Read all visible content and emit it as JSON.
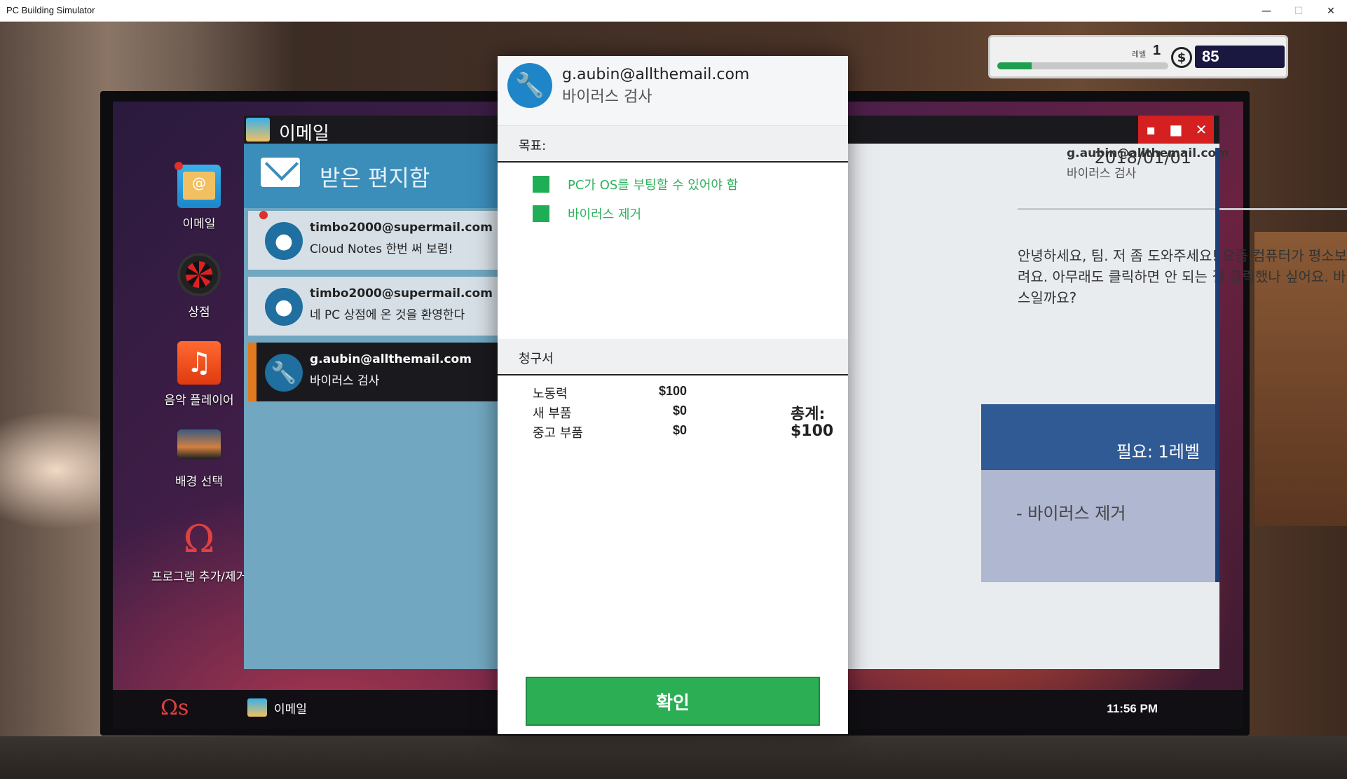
{
  "window": {
    "title": "PC Building Simulator"
  },
  "hud": {
    "level_label": "레벨",
    "level": "1",
    "currency_icon": "$",
    "money": "85",
    "xp_progress": 0.2
  },
  "desktop": {
    "icons": [
      {
        "label": "이메일"
      },
      {
        "label": "상점"
      },
      {
        "label": "음악 플레이어"
      },
      {
        "label": "배경 선택"
      },
      {
        "label": "프로그램 추가/제거"
      }
    ]
  },
  "taskbar": {
    "task_label": "이메일",
    "clock": "11:56 PM"
  },
  "email_app": {
    "title": "이메일",
    "inbox_title": "받은 편지함",
    "messages": [
      {
        "from": "timbo2000@supermail.com",
        "subject": "Cloud Notes 한번 써 보렴!"
      },
      {
        "from": "timbo2000@supermail.com",
        "subject": "네 PC 상점에 온 것을 환영한다"
      },
      {
        "from": "g.aubin@allthemail.com",
        "subject": "바이러스 검사"
      }
    ],
    "reader": {
      "from": "g.aubin@allthemail.com",
      "subject": "바이러스 검사",
      "date": "2018/01/01",
      "body": "안녕하세요, 팀. 저 좀 도와주세요! 요즘 컴퓨터가 평소보다 느려요. 아무래도 클릭하면 안 되는 걸 클릭했나 싶어요. 바이러스일까요?",
      "required": "필요: 1레벨",
      "goal": "- 바이러스 제거"
    }
  },
  "modal": {
    "from": "g.aubin@allthemail.com",
    "subject": "바이러스 검사",
    "objectives_header": "목표:",
    "objectives": [
      {
        "text": "PC가 OS를 부팅할 수 있어야 함"
      },
      {
        "text": "바이러스 제거"
      }
    ],
    "invoice_header": "청구서",
    "invoice": [
      {
        "label": "노동력",
        "value": "$100"
      },
      {
        "label": "새 부품",
        "value": "$0"
      },
      {
        "label": "중고 부품",
        "value": "$0"
      }
    ],
    "total_label": "총계:",
    "total_value": "$100",
    "confirm_label": "확인"
  }
}
